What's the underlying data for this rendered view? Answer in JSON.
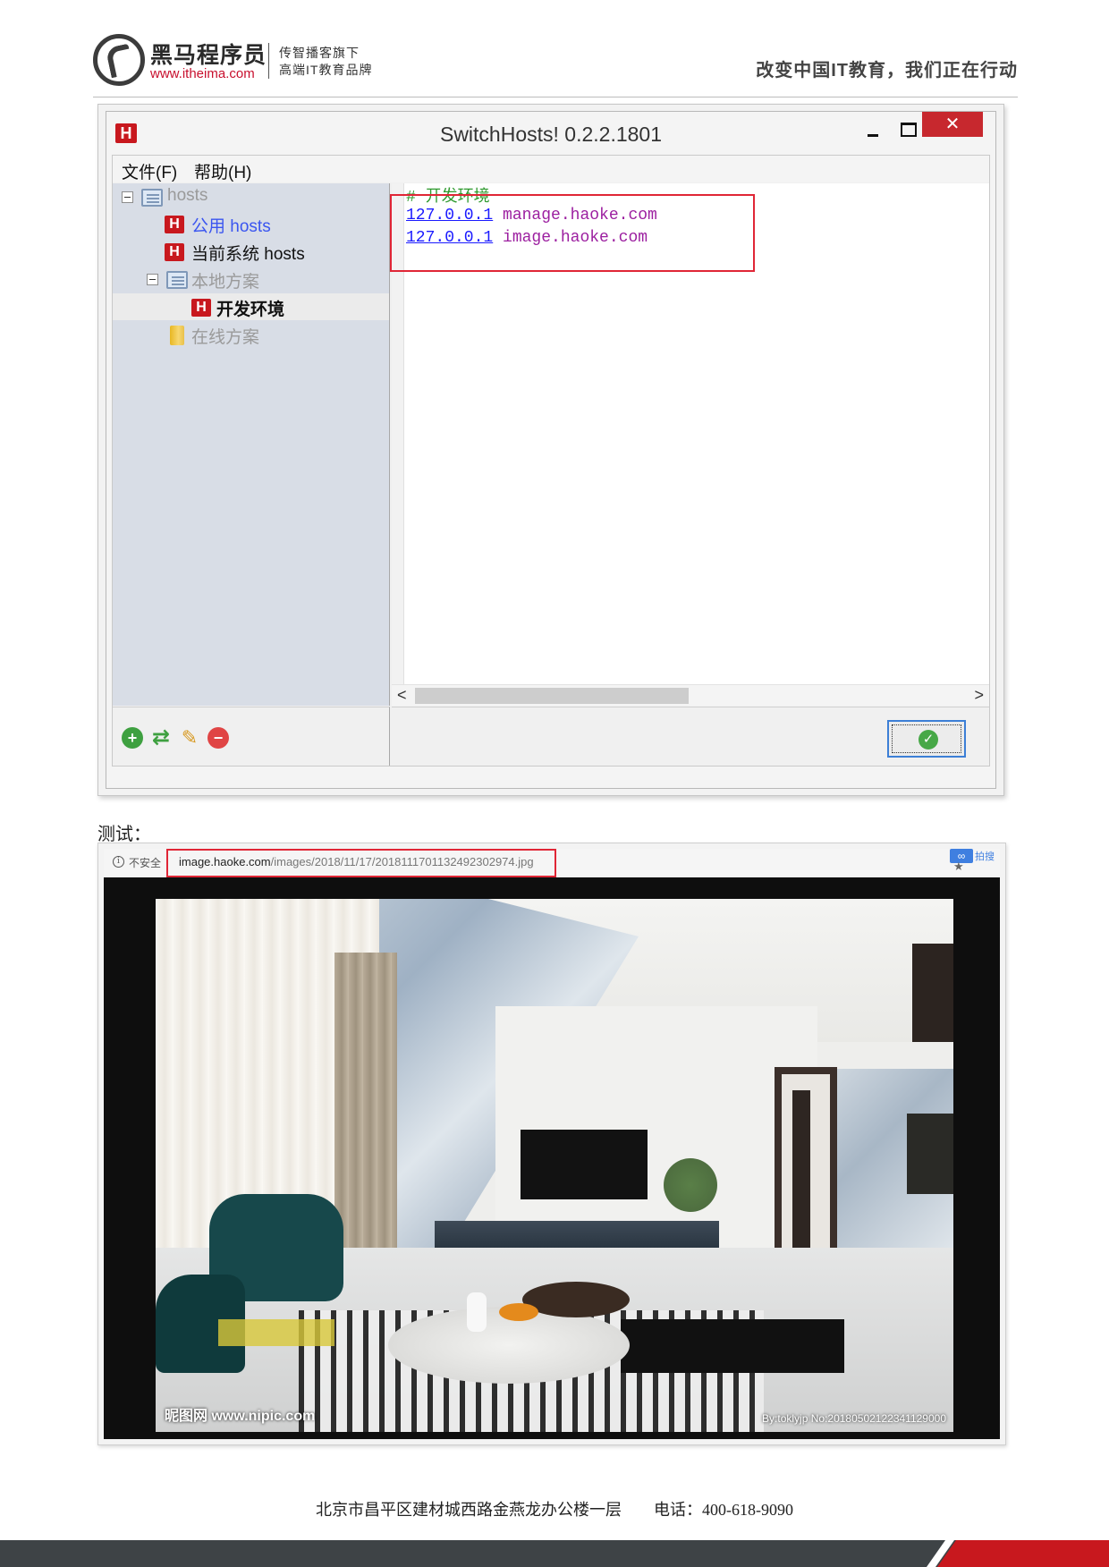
{
  "header": {
    "logo_name": "黑马程序员",
    "logo_url": "www.itheima.com",
    "tagline_line1": "传智播客旗下",
    "tagline_line2": "高端IT教育品牌",
    "slogan": "改变中国IT教育，我们正在行动"
  },
  "window": {
    "title": "SwitchHosts! 0.2.2.1801",
    "app_icon": "H",
    "close_glyph": "✕",
    "menu": [
      "文件(F)",
      "帮助(H)"
    ],
    "tree": {
      "root": "hosts",
      "public": "公用 hosts",
      "system": "当前系统 hosts",
      "local_group": "本地方案",
      "dev_env": "开发环境",
      "online_group": "在线方案"
    },
    "editor": {
      "comment": "# 开发环境",
      "lines": [
        {
          "ip": "127.0.0.1",
          "host": "manage.haoke.com"
        },
        {
          "ip": "127.0.0.1",
          "host": "image.haoke.com"
        }
      ]
    },
    "scroll_left": "<",
    "scroll_right": ">",
    "tools": {
      "add": "+",
      "refresh": "⇄",
      "edit": "✎",
      "delete": "−"
    },
    "ok_glyph": "✓"
  },
  "test_label": "测试：",
  "browser": {
    "insecure": "不安全",
    "url_host": "image.haoke.com",
    "url_path": "/images/2018/11/17/2018111701132492302974.jpg",
    "ext_icon": "∞",
    "ext_text": "拍搜",
    "star": "★",
    "watermark_left": "昵图网 www.nipic.com",
    "watermark_right": "By:toklyjp No:20180502122341129000"
  },
  "footer": {
    "address": "北京市昌平区建材城西路金燕龙办公楼一层",
    "phone": "电话：400-618-9090"
  }
}
